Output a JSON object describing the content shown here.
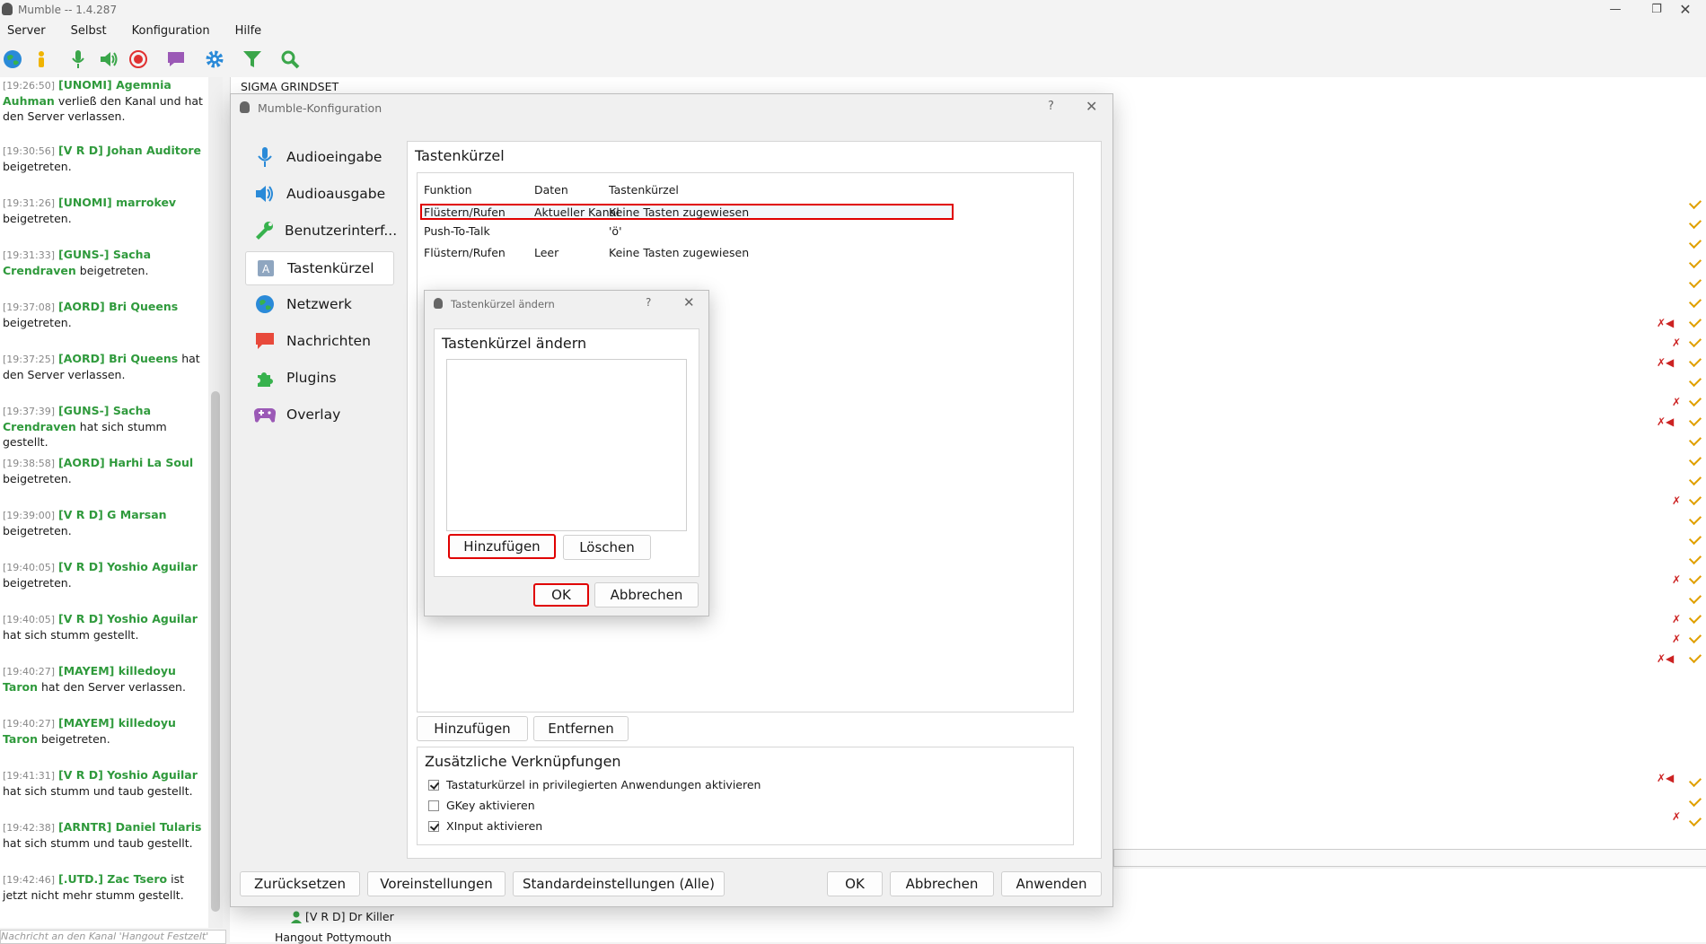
{
  "window": {
    "title": "Mumble -- 1.4.287"
  },
  "menu": [
    "Server",
    "Selbst",
    "Konfiguration",
    "Hilfe"
  ],
  "toolbar": [
    "globe-icon",
    "info-icon",
    "microphone-icon",
    "speaker-icon",
    "record-icon",
    "chat-icon",
    "gear-icon",
    "filter-icon",
    "search-icon"
  ],
  "chat": [
    {
      "ts": "[19:26:50]",
      "name": "[UNOMI] Agemnia Auhman",
      "text": "verließ den Kanal und hat den Server verlassen."
    },
    {
      "ts": "[19:30:56]",
      "name": "[V R D] Johan Auditore",
      "text": "beigetreten."
    },
    {
      "ts": "[19:31:26]",
      "name": "[UNOMI] marrokev",
      "text": "beigetreten."
    },
    {
      "ts": "[19:31:33]",
      "name": "[GUNS-] Sacha Crendraven",
      "text": "beigetreten."
    },
    {
      "ts": "[19:37:08]",
      "name": "[AORD] Bri Queens",
      "text": "beigetreten."
    },
    {
      "ts": "[19:37:25]",
      "name": "[AORD] Bri Queens",
      "text": "hat den Server verlassen."
    },
    {
      "ts": "[19:37:39]",
      "name": "[GUNS-] Sacha Crendraven",
      "text": "hat sich stumm gestellt."
    },
    {
      "ts": "[19:38:58]",
      "name": "[AORD] Harhi La Soul",
      "text": "beigetreten."
    },
    {
      "ts": "[19:39:00]",
      "name": "[V R D] G Marsan",
      "text": "beigetreten."
    },
    {
      "ts": "[19:40:05]",
      "name": "[V R D] Yoshio Aguilar",
      "text": "beigetreten."
    },
    {
      "ts": "[19:40:05]",
      "name": "[V R D] Yoshio Aguilar",
      "text": "hat sich stumm gestellt."
    },
    {
      "ts": "[19:40:27]",
      "name": "[MAYEM] killedoyu Taron",
      "text": "hat den Server verlassen."
    },
    {
      "ts": "[19:40:27]",
      "name": "[MAYEM] killedoyu Taron",
      "text": "beigetreten."
    },
    {
      "ts": "[19:41:31]",
      "name": "[V R D] Yoshio Aguilar",
      "text": "hat sich stumm und taub gestellt."
    },
    {
      "ts": "[19:42:38]",
      "name": "[ARNTR] Daniel Tularis",
      "text": "hat sich stumm und taub gestellt."
    },
    {
      "ts": "[19:42:46]",
      "name": "[.UTD.] Zac Tsero",
      "text": "ist jetzt nicht mehr stumm gestellt."
    }
  ],
  "message_placeholder": "Nachricht an den Kanal 'Hangout Festzelt'",
  "channel": {
    "title": "SIGMA GRINDSET"
  },
  "bottom_tree": {
    "user": "[V R D] Dr Killer",
    "channel": "Hangout Pottymouth"
  },
  "config": {
    "title": "Mumble-Konfiguration",
    "help": "?",
    "nav": [
      {
        "label": "Audioeingabe",
        "icon": "microphone-icon"
      },
      {
        "label": "Audioausgabe",
        "icon": "speaker-icon"
      },
      {
        "label": "Benutzerinterf...",
        "icon": "wrench-icon"
      },
      {
        "label": "Tastenkürzel",
        "icon": "keyboard-icon"
      },
      {
        "label": "Netzwerk",
        "icon": "globe-icon"
      },
      {
        "label": "Nachrichten",
        "icon": "message-icon"
      },
      {
        "label": "Plugins",
        "icon": "puzzle-icon"
      },
      {
        "label": "Overlay",
        "icon": "gamepad-icon"
      }
    ],
    "section_title": "Tastenkürzel",
    "columns": [
      "Funktion",
      "Daten",
      "Tastenkürzel"
    ],
    "rows": [
      {
        "funktion": "Flüstern/Rufen",
        "daten": "Aktueller Kanal",
        "key": "Keine Tasten zugewiesen"
      },
      {
        "funktion": "Push-To-Talk",
        "daten": "",
        "key": "'ö'"
      },
      {
        "funktion": "Flüstern/Rufen",
        "daten": "Leer",
        "key": "Keine Tasten zugewiesen"
      }
    ],
    "add_label": "Hinzufügen",
    "remove_label": "Entfernen",
    "extra_title": "Zusätzliche Verknüpfungen",
    "options": [
      {
        "label": "Tastaturkürzel in privilegierten Anwendungen aktivieren",
        "checked": true
      },
      {
        "label": "GKey aktivieren",
        "checked": false
      },
      {
        "label": "XInput aktivieren",
        "checked": true
      }
    ],
    "buttons": {
      "reset": "Zurücksetzen",
      "presets": "Voreinstellungen",
      "defaults": "Standardeinstellungen (Alle)",
      "ok": "OK",
      "cancel": "Abbrechen",
      "apply": "Anwenden"
    }
  },
  "shortcut_dialog": {
    "title": "Tastenkürzel ändern",
    "heading": "Tastenkürzel ändern",
    "help": "?",
    "add": "Hinzufügen",
    "delete": "Löschen",
    "ok": "OK",
    "cancel": "Abbrechen"
  },
  "colors": {
    "accent_red": "#e00000",
    "name_green": "#2f9a3c",
    "check_yellow": "#e0a000"
  }
}
